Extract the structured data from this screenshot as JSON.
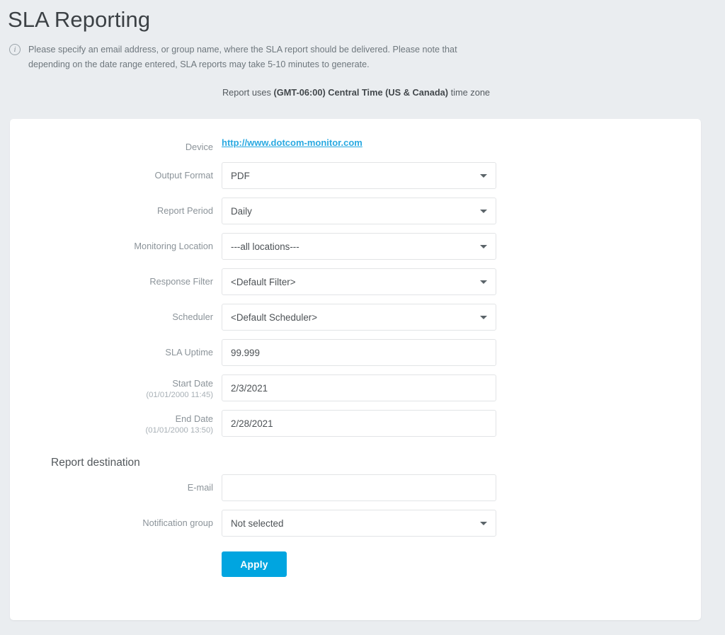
{
  "page": {
    "title": "SLA Reporting",
    "info_icon": "info-circle-icon",
    "info_text": "Please specify an email address, or group name, where the SLA report should be delivered. Please note that depending on the date range entered, SLA reports may take 5-10 minutes to generate.",
    "timezone_note": {
      "prefix": "Report uses ",
      "bold": "(GMT-06:00) Central Time (US & Canada)",
      "suffix": " time zone"
    }
  },
  "colors": {
    "background": "#eaedf0",
    "card": "#ffffff",
    "accent": "#00a5e0",
    "link": "#29a9e1",
    "label": "#8b9399",
    "border": "#e2e4e6"
  },
  "form": {
    "device": {
      "label": "Device",
      "value": "http://www.dotcom-monitor.com"
    },
    "output_format": {
      "label": "Output Format",
      "value": "PDF",
      "caret": "chevron-down-icon"
    },
    "report_period": {
      "label": "Report Period",
      "value": "Daily",
      "caret": "chevron-down-icon"
    },
    "monitoring_location": {
      "label": "Monitoring Location",
      "value": "---all locations---",
      "caret": "chevron-down-icon"
    },
    "response_filter": {
      "label": "Response Filter",
      "value": "<Default Filter>",
      "caret": "chevron-down-icon"
    },
    "scheduler": {
      "label": "Scheduler",
      "value": "<Default Scheduler>",
      "caret": "chevron-down-icon"
    },
    "sla_uptime": {
      "label": "SLA Uptime",
      "value": "99.999",
      "placeholder": ""
    },
    "start_date": {
      "label": "Start Date",
      "hint": "(01/01/2000 11:45)",
      "value": "2/3/2021",
      "placeholder": ""
    },
    "end_date": {
      "label": "End Date",
      "hint": "(01/01/2000 13:50)",
      "value": "2/28/2021",
      "placeholder": ""
    }
  },
  "destination": {
    "heading": "Report destination",
    "email": {
      "label": "E-mail",
      "value": "",
      "placeholder": ""
    },
    "notification_group": {
      "label": "Notification group",
      "value": "Not selected",
      "caret": "chevron-down-icon"
    }
  },
  "actions": {
    "apply_label": "Apply"
  }
}
